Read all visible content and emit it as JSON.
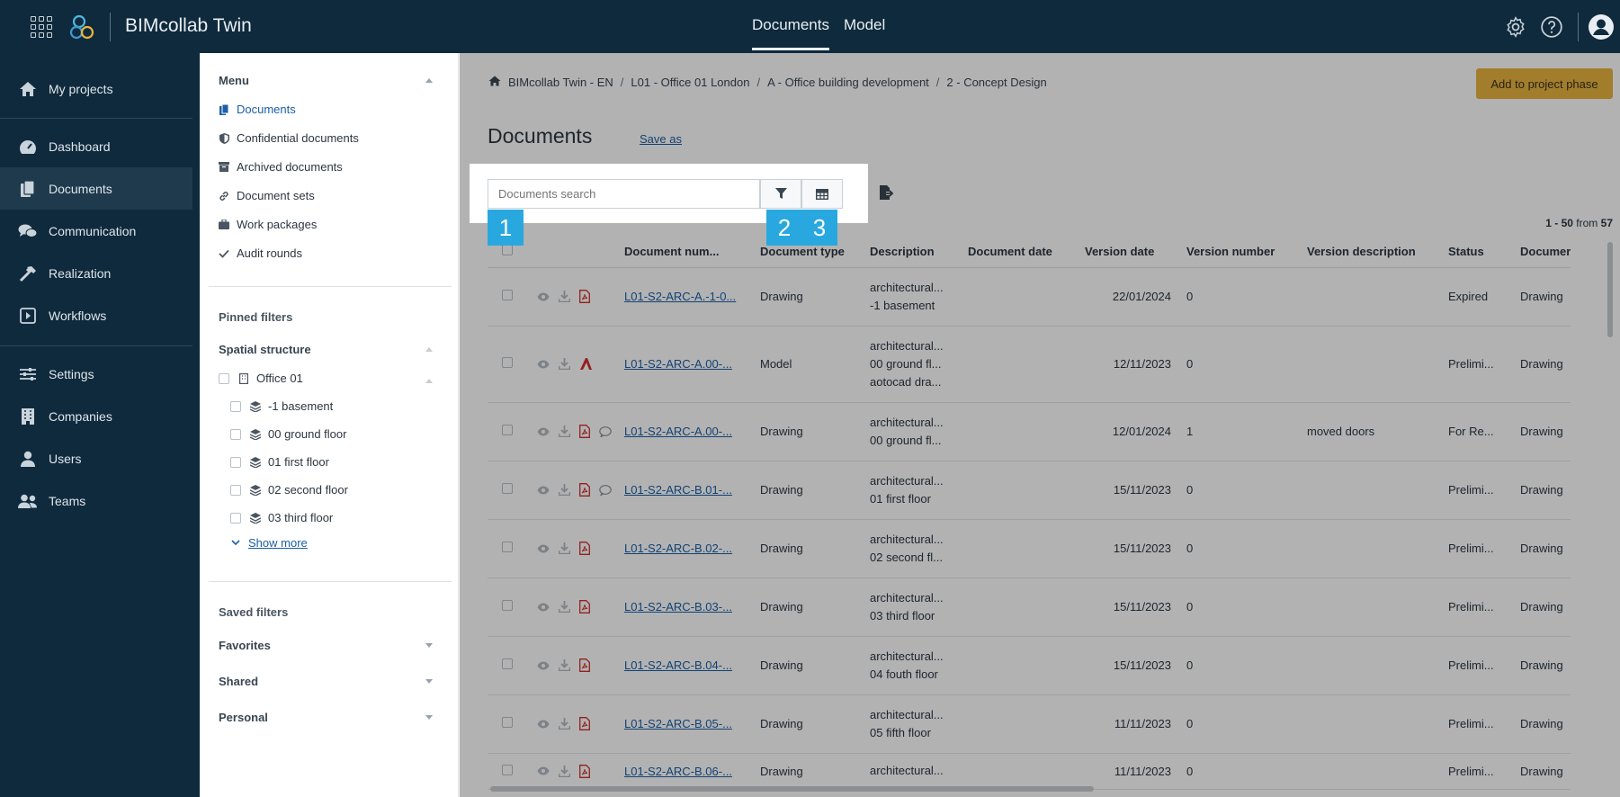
{
  "topbar": {
    "app_name": "BIMcollab Twin",
    "nav": [
      {
        "label": "Documents",
        "active": true
      },
      {
        "label": "Model",
        "active": false
      }
    ]
  },
  "leftnav": {
    "items": [
      {
        "label": "My projects",
        "icon": "home-icon"
      },
      {
        "label": "Dashboard",
        "icon": "gauge-icon"
      },
      {
        "label": "Documents",
        "icon": "documents-icon",
        "active": true
      },
      {
        "label": "Communication",
        "icon": "chat-icon"
      },
      {
        "label": "Realization",
        "icon": "hammer-icon"
      },
      {
        "label": "Workflows",
        "icon": "workflow-icon"
      },
      {
        "label": "Settings",
        "icon": "sliders-icon"
      },
      {
        "label": "Companies",
        "icon": "building-icon"
      },
      {
        "label": "Users",
        "icon": "user-icon"
      },
      {
        "label": "Teams",
        "icon": "team-icon"
      }
    ]
  },
  "submenu": {
    "menu_header": "Menu",
    "menu_items": [
      {
        "label": "Documents",
        "icon": "documents-icon",
        "active": true
      },
      {
        "label": "Confidential documents",
        "icon": "shield-icon"
      },
      {
        "label": "Archived documents",
        "icon": "archive-icon"
      },
      {
        "label": "Document sets",
        "icon": "link-icon"
      },
      {
        "label": "Work packages",
        "icon": "briefcase-icon"
      },
      {
        "label": "Audit rounds",
        "icon": "check-icon"
      }
    ],
    "pinned_header": "Pinned filters",
    "spatial_header": "Spatial structure",
    "office": "Office 01",
    "floors": [
      "-1 basement",
      "00 ground floor",
      "01 first floor",
      "02 second floor",
      "03 third floor"
    ],
    "show_more": "Show more",
    "saved_header": "Saved filters",
    "favorites": "Favorites",
    "shared": "Shared",
    "personal": "Personal"
  },
  "main": {
    "breadcrumb": [
      "BIMcollab Twin - EN",
      "L01 - Office 01 London",
      "A - Office building development",
      "2 - Concept Design"
    ],
    "add_button": "Add to project phase",
    "title": "Documents",
    "save_as": "Save as",
    "search_placeholder": "Documents search",
    "badges": [
      "1",
      "2",
      "3"
    ],
    "count_range": "1 - 50",
    "count_from": "from",
    "count_total": "57",
    "columns": [
      "Document num...",
      "Document type",
      "Description",
      "Document date",
      "Version date",
      "Version number",
      "Version description",
      "Status",
      "Documer"
    ],
    "rows": [
      {
        "num": "L01-S2-ARC-A.-1-0...",
        "file": "pdf",
        "comment": false,
        "type": "Drawing",
        "desc": [
          "architectural...",
          "-1 basement"
        ],
        "doc_date": "",
        "ver_date": "22/01/2024",
        "ver_num": "0",
        "ver_desc": "",
        "status": "Expired",
        "doc": "Drawing"
      },
      {
        "num": "L01-S2-ARC-A.00-...",
        "file": "autocad",
        "comment": false,
        "type": "Model",
        "desc": [
          "architectural...",
          "00 ground fl...",
          "aotocad dra..."
        ],
        "doc_date": "",
        "ver_date": "12/11/2023",
        "ver_num": "0",
        "ver_desc": "",
        "status": "Prelimi...",
        "doc": "Drawing"
      },
      {
        "num": "L01-S2-ARC-A.00-...",
        "file": "pdf",
        "comment": true,
        "type": "Drawing",
        "desc": [
          "architectural...",
          "00 ground fl..."
        ],
        "doc_date": "",
        "ver_date": "12/01/2024",
        "ver_num": "1",
        "ver_desc": "moved doors",
        "status": "For Re...",
        "doc": "Drawing"
      },
      {
        "num": "L01-S2-ARC-B.01-...",
        "file": "pdf",
        "comment": true,
        "type": "Drawing",
        "desc": [
          "architectural...",
          "01 first floor"
        ],
        "doc_date": "",
        "ver_date": "15/11/2023",
        "ver_num": "0",
        "ver_desc": "",
        "status": "Prelimi...",
        "doc": "Drawing"
      },
      {
        "num": "L01-S2-ARC-B.02-...",
        "file": "pdf",
        "comment": false,
        "type": "Drawing",
        "desc": [
          "architectural...",
          "02 second fl..."
        ],
        "doc_date": "",
        "ver_date": "15/11/2023",
        "ver_num": "0",
        "ver_desc": "",
        "status": "Prelimi...",
        "doc": "Drawing"
      },
      {
        "num": "L01-S2-ARC-B.03-...",
        "file": "pdf",
        "comment": false,
        "type": "Drawing",
        "desc": [
          "architectural...",
          "03 third floor"
        ],
        "doc_date": "",
        "ver_date": "15/11/2023",
        "ver_num": "0",
        "ver_desc": "",
        "status": "Prelimi...",
        "doc": "Drawing"
      },
      {
        "num": "L01-S2-ARC-B.04-...",
        "file": "pdf",
        "comment": false,
        "type": "Drawing",
        "desc": [
          "architectural...",
          "04 fouth floor"
        ],
        "doc_date": "",
        "ver_date": "15/11/2023",
        "ver_num": "0",
        "ver_desc": "",
        "status": "Prelimi...",
        "doc": "Drawing"
      },
      {
        "num": "L01-S2-ARC-B.05-...",
        "file": "pdf",
        "comment": false,
        "type": "Drawing",
        "desc": [
          "architectural...",
          "05 fifth floor"
        ],
        "doc_date": "",
        "ver_date": "11/11/2023",
        "ver_num": "0",
        "ver_desc": "",
        "status": "Prelimi...",
        "doc": "Drawing"
      },
      {
        "num": "L01-S2-ARC-B.06-...",
        "file": "pdf",
        "comment": false,
        "type": "Drawing",
        "desc": [
          "architectural..."
        ],
        "doc_date": "",
        "ver_date": "11/11/2023",
        "ver_num": "0",
        "ver_desc": "",
        "status": "Prelimi...",
        "doc": "Drawing"
      }
    ]
  },
  "colors": {
    "nav_bg": "#0f2a3c",
    "accent_button": "#e8b53f",
    "link": "#1b5fa6",
    "badge": "#28a8df",
    "pdf_red": "#d2302f"
  }
}
